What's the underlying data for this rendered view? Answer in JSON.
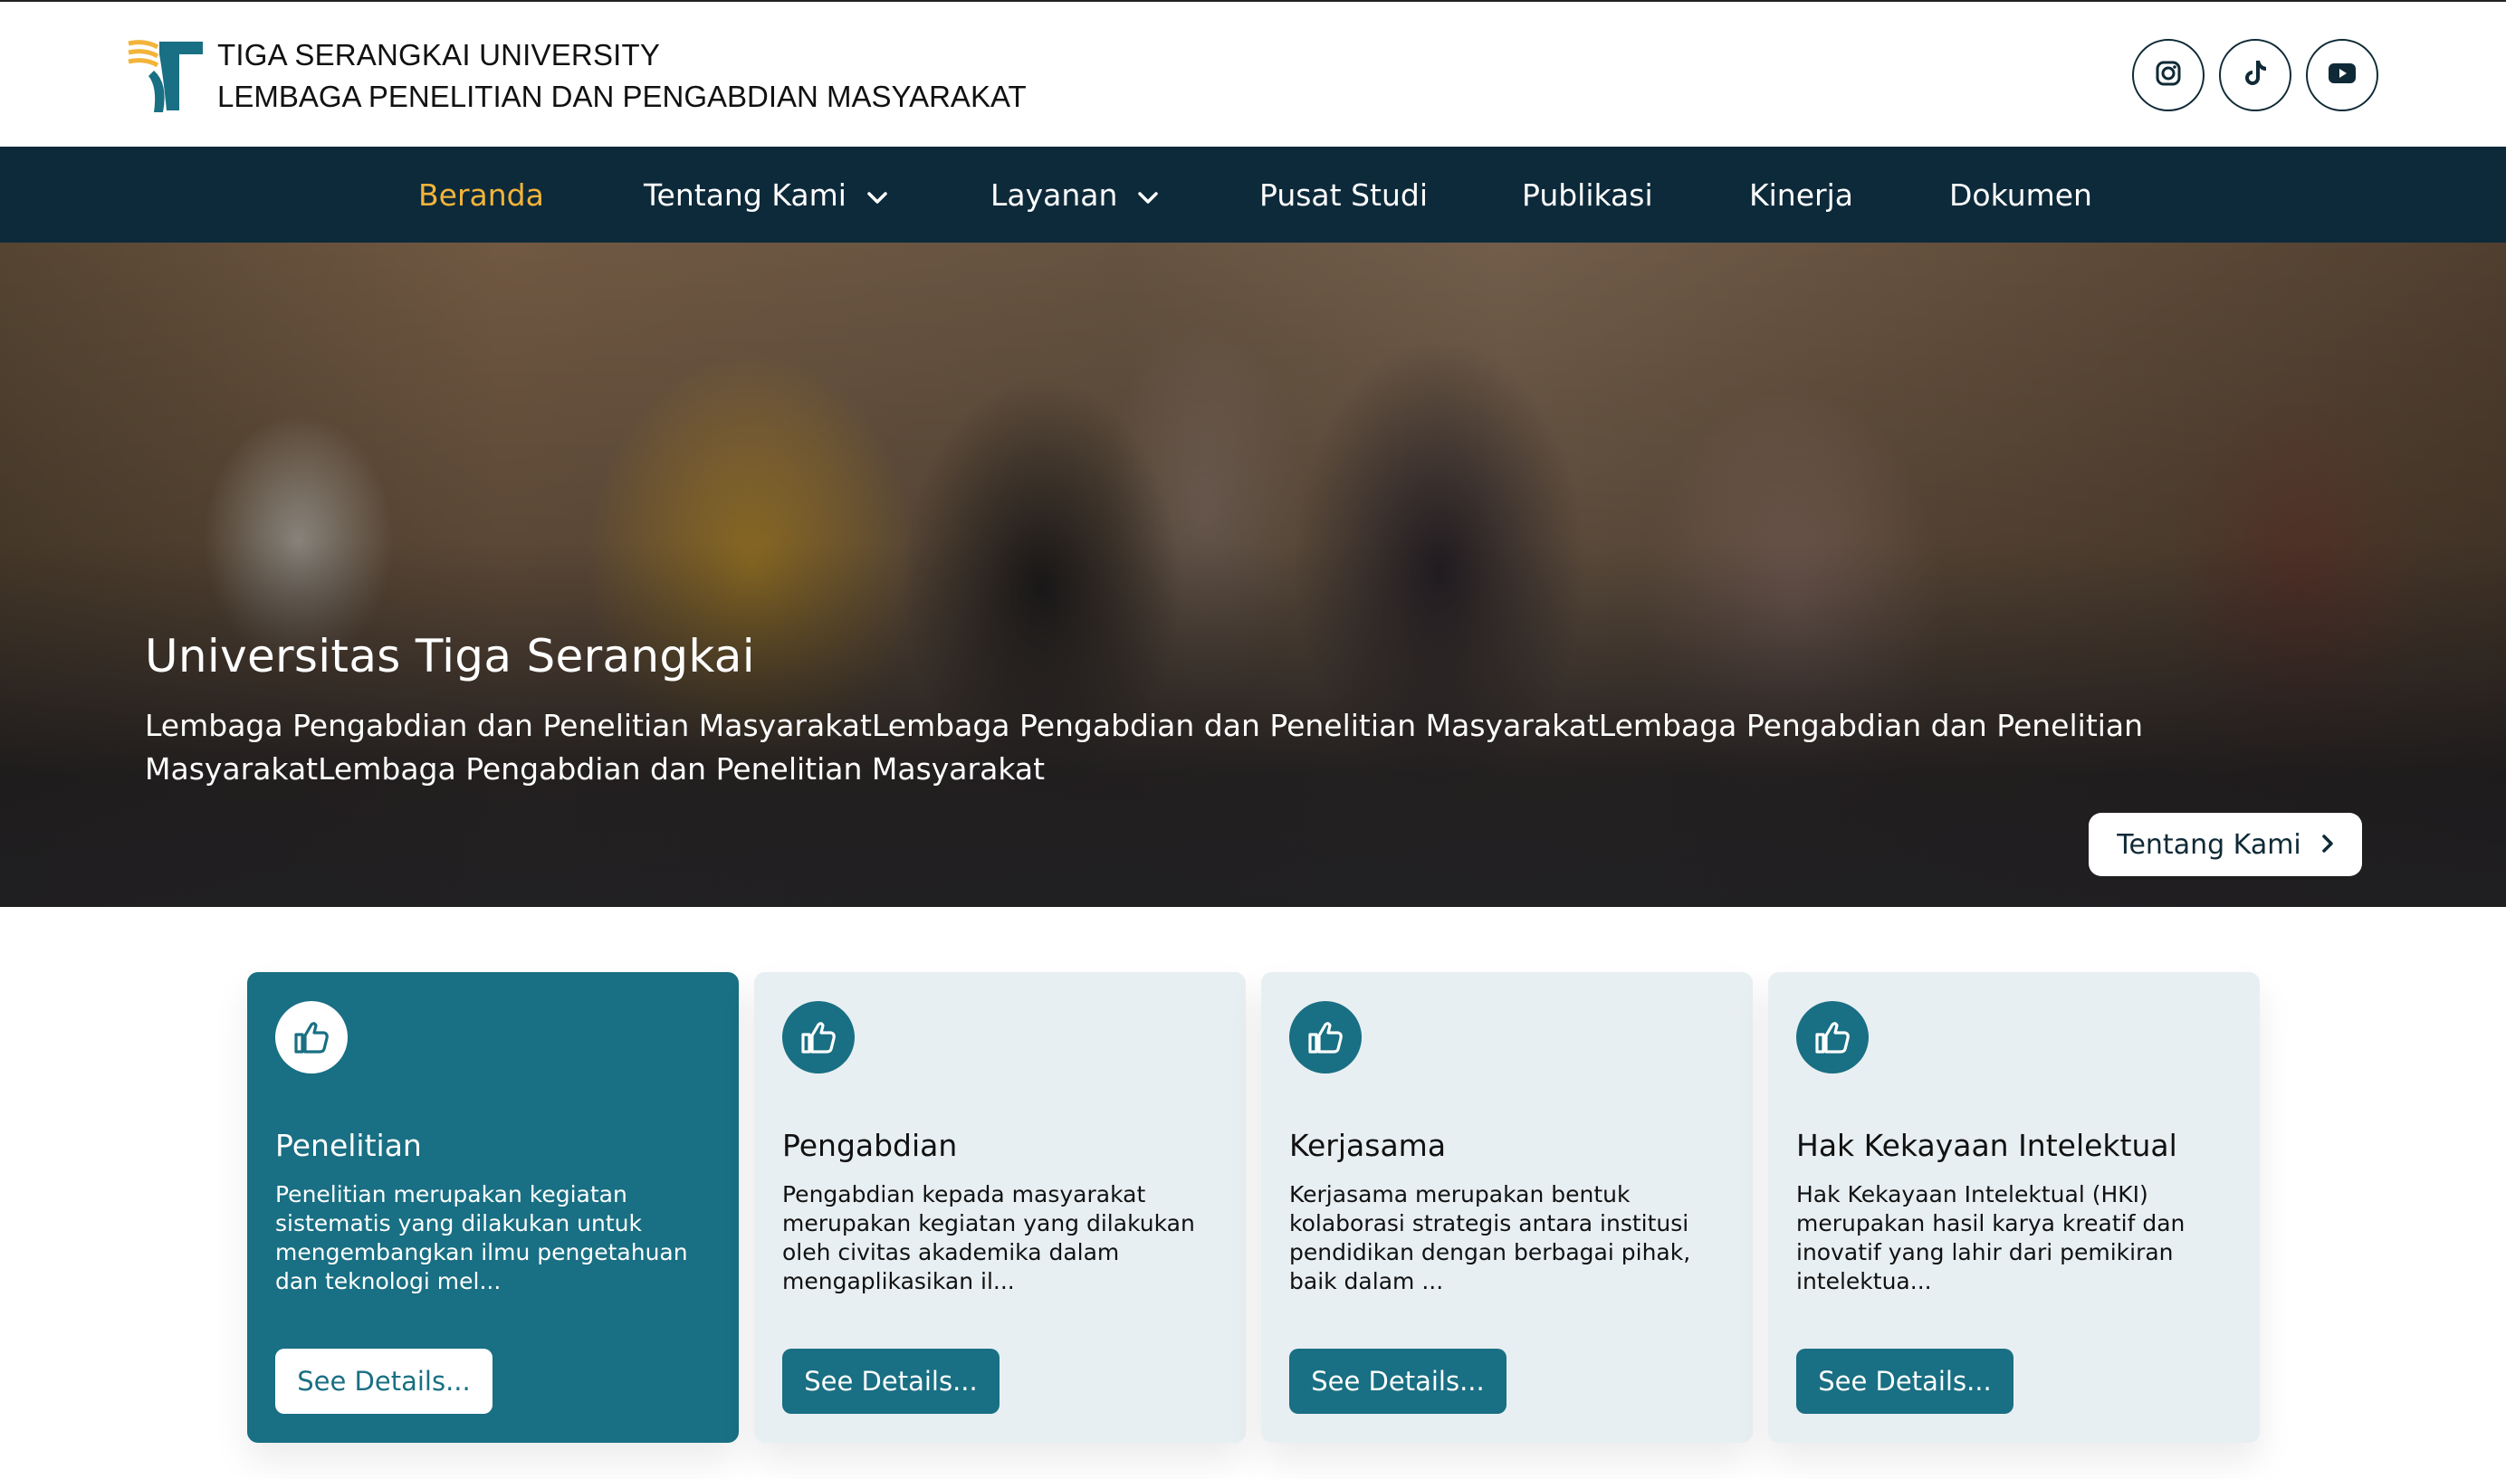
{
  "header": {
    "line1": "TIGA SERANGKAI UNIVERSITY",
    "line2": "LEMBAGA PENELITIAN DAN PENGABDIAN MASYARAKAT",
    "social": [
      "instagram-icon",
      "tiktok-icon",
      "youtube-icon"
    ]
  },
  "nav": {
    "items": [
      {
        "label": "Beranda"
      },
      {
        "label": "Tentang Kami"
      },
      {
        "label": "Layanan"
      },
      {
        "label": "Pusat Studi"
      },
      {
        "label": "Publikasi"
      },
      {
        "label": "Kinerja"
      },
      {
        "label": "Dokumen"
      }
    ]
  },
  "hero": {
    "title": "Universitas Tiga Serangkai",
    "description": "Lembaga Pengabdian dan Penelitian MasyarakatLembaga Pengabdian dan Penelitian MasyarakatLembaga Pengabdian dan Penelitian MasyarakatLembaga Pengabdian dan Penelitian Masyarakat",
    "button": "Tentang Kami"
  },
  "cards": [
    {
      "title": "Penelitian",
      "text": "Penelitian merupakan kegiatan sistematis yang dilakukan untuk mengembangkan ilmu pengetahuan dan teknologi mel...",
      "button": "See Details..."
    },
    {
      "title": "Pengabdian",
      "text": "Pengabdian kepada masyarakat merupakan kegiatan yang dilakukan oleh civitas akademika dalam mengaplikasikan il...",
      "button": "See Details..."
    },
    {
      "title": "Kerjasama",
      "text": "Kerjasama merupakan bentuk kolaborasi strategis antara institusi pendidikan dengan berbagai pihak, baik dalam ...",
      "button": "See Details..."
    },
    {
      "title": "Hak Kekayaan Intelektual",
      "text": "Hak Kekayaan Intelektual (HKI) merupakan hasil karya kreatif dan inovatif yang lahir dari pemikiran intelektua...",
      "button": "See Details..."
    }
  ],
  "colors": {
    "primary": "#196f83",
    "nav_bg": "#0d2a3a",
    "accent": "#f2b43a",
    "card_bg": "#e8eff2"
  }
}
